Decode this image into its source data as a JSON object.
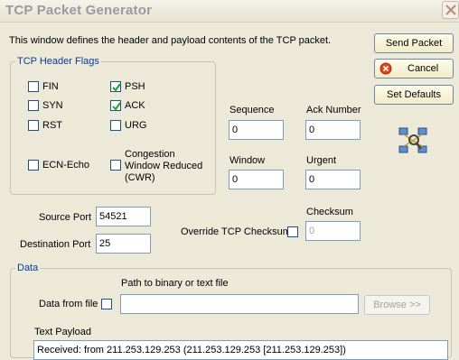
{
  "window": {
    "title": "TCP Packet Generator",
    "description": "This window defines the header and payload contents of the TCP packet."
  },
  "buttons": {
    "send": "Send Packet",
    "cancel": "Cancel",
    "defaults": "Set Defaults",
    "browse": "Browse >>"
  },
  "flags": {
    "group_label": "TCP Header Flags",
    "fin": "FIN",
    "syn": "SYN",
    "rst": "RST",
    "psh": "PSH",
    "ack": "ACK",
    "urg": "URG",
    "ecn": "ECN-Echo",
    "cwr_line1": "Congestion",
    "cwr_line2": "Window Reduced",
    "cwr_line3": "(CWR)"
  },
  "fields": {
    "sequence_label": "Sequence",
    "sequence_value": "0",
    "ack_number_label": "Ack Number",
    "ack_number_value": "0",
    "window_label": "Window",
    "window_value": "0",
    "urgent_label": "Urgent",
    "urgent_value": "0",
    "source_port_label": "Source Port",
    "source_port_value": "54521",
    "dest_port_label": "Destination Port",
    "dest_port_value": "25",
    "override_checksum_label": "Override TCP Checksum",
    "checksum_label": "Checksum",
    "checksum_value": "0"
  },
  "data": {
    "group_label": "Data",
    "path_label": "Path to binary or text file",
    "data_from_file_label": "Data from file",
    "path_value": "",
    "text_payload_label": "Text Payload",
    "payload_value": "Received: from 211.253.129.253 (211.253.129.253 [211.253.129.253])"
  },
  "colors": {
    "group_label": "#0a3b9b",
    "checkmark": "#21a121",
    "cancel_icon": "#e2451e"
  }
}
